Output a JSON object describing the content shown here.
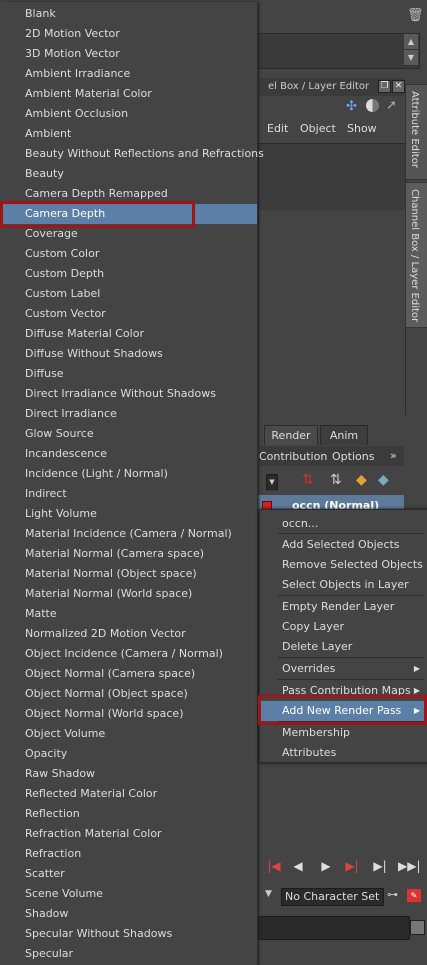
{
  "channel_box": {
    "title": "el Box / Layer Editor",
    "menu": [
      "Edit",
      "Object",
      "Show"
    ]
  },
  "side_tabs": {
    "attribute_editor": "Attribute Editor",
    "channel_box": "Channel Box / Layer Editor"
  },
  "layer_editor": {
    "tabs": [
      "Render",
      "Anim"
    ],
    "menu": [
      "Contribution",
      "Options"
    ],
    "more": "»",
    "layer_name": "occn (Normal)"
  },
  "pass_list": [
    "Blank",
    "2D Motion Vector",
    "3D Motion Vector",
    "Ambient Irradiance",
    "Ambient Material Color",
    "Ambient Occlusion",
    "Ambient",
    "Beauty Without Reflections and Refractions",
    "Beauty",
    "Camera Depth Remapped",
    "Camera Depth",
    "Coverage",
    "Custom Color",
    "Custom Depth",
    "Custom Label",
    "Custom Vector",
    "Diffuse Material Color",
    "Diffuse Without Shadows",
    "Diffuse",
    "Direct Irradiance Without Shadows",
    "Direct Irradiance",
    "Glow Source",
    "Incandescence",
    "Incidence (Light / Normal)",
    "Indirect",
    "Light Volume",
    "Material Incidence (Camera / Normal)",
    "Material Normal (Camera space)",
    "Material Normal (Object space)",
    "Material Normal (World space)",
    "Matte",
    "Normalized 2D Motion Vector",
    "Object Incidence (Camera / Normal)",
    "Object Normal (Camera space)",
    "Object Normal (Object space)",
    "Object Normal (World space)",
    "Object Volume",
    "Opacity",
    "Raw Shadow",
    "Reflected Material Color",
    "Reflection",
    "Refraction Material Color",
    "Refraction",
    "Scatter",
    "Scene Volume",
    "Shadow",
    "Specular Without Shadows",
    "Specular"
  ],
  "selected_pass": "Camera Depth",
  "context_menu": {
    "items": [
      {
        "label": "occn...",
        "submenu": false
      },
      {
        "label": "Add Selected Objects",
        "submenu": false
      },
      {
        "label": "Remove Selected Objects",
        "submenu": false
      },
      {
        "label": "Select Objects in Layer",
        "submenu": false
      },
      {
        "label": "Empty Render Layer",
        "submenu": false
      },
      {
        "label": "Copy Layer",
        "submenu": false
      },
      {
        "label": "Delete Layer",
        "submenu": false
      },
      {
        "label": "Overrides",
        "submenu": true
      },
      {
        "label": "Pass Contribution Maps",
        "submenu": true
      },
      {
        "label": "Add New Render Pass",
        "submenu": true
      },
      {
        "label": "Membership",
        "submenu": false
      },
      {
        "label": "Attributes",
        "submenu": false
      }
    ],
    "selected": "Add New Render Pass"
  },
  "character_set": "No Character Set",
  "colors": {
    "selection": "#5b7fa6",
    "highlight_border": "#a01515",
    "panel": "#444444"
  }
}
